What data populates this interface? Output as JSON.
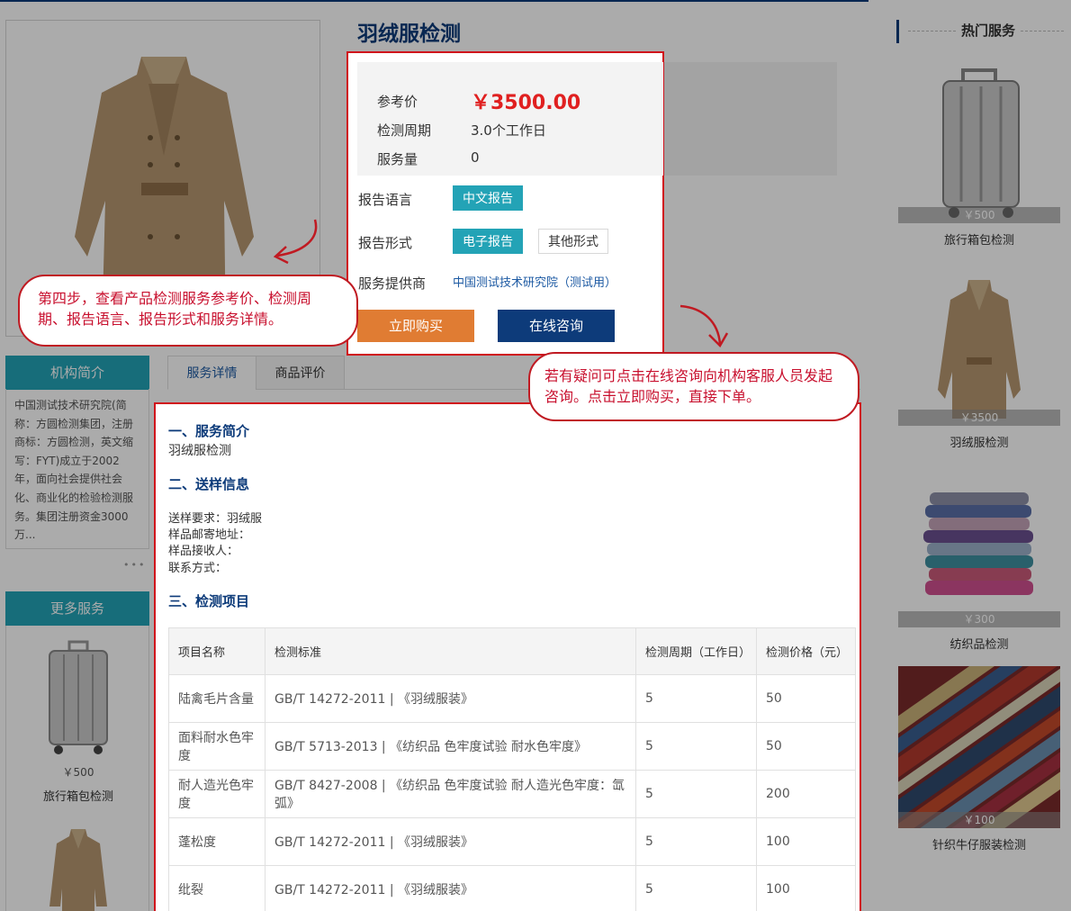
{
  "product": {
    "title": "羽绒服检测",
    "price_label": "参考价",
    "price": "￥3500.00",
    "cycle_label": "检测周期",
    "cycle": "3.0个工作日",
    "volume_label": "服务量",
    "volume": "0",
    "lang_label": "报告语言",
    "lang_option": "中文报告",
    "format_label": "报告形式",
    "format_options": [
      "电子报告",
      "其他形式"
    ],
    "provider_label": "服务提供商",
    "provider": "中国测试技术研究院（测试用）",
    "buy_button": "立即购买",
    "consult_button": "在线咨询"
  },
  "org": {
    "heading": "机构简介",
    "description": "中国测试技术研究院(简称：方圆检测集团，注册商标：方圆检测，英文缩写：FYT)成立于2002年，面向社会提供社会化、商业化的检验检测服务。集团注册资金3000万...",
    "more_dots": "•••"
  },
  "more": {
    "heading": "更多服务",
    "items": [
      {
        "price": "￥500",
        "name": "旅行箱包检测"
      }
    ]
  },
  "tabs": [
    "服务详情",
    "商品评价"
  ],
  "detail": {
    "sec1_title": "一、服务简介",
    "sec1_text": "羽绒服检测",
    "sec2_title": "二、送样信息",
    "sample_req": "送样要求：羽绒服",
    "sample_addr": "样品邮寄地址：",
    "sample_recv": "样品接收人：",
    "contact": "联系方式：",
    "sec3_title": "三、检测项目",
    "table_headers": [
      "项目名称",
      "检测标准",
      "检测周期（工作日）",
      "检测价格（元）"
    ],
    "rows": [
      [
        "陆禽毛片含量",
        "GB/T 14272-2011 | 《羽绒服装》",
        "5",
        "50"
      ],
      [
        "面料耐水色牢度",
        "GB/T 5713-2013 | 《纺织品 色牢度试验 耐水色牢度》",
        "5",
        "50"
      ],
      [
        "耐人造光色牢度",
        "GB/T 8427-2008 | 《纺织品 色牢度试验 耐人造光色牢度：氙弧》",
        "5",
        "200"
      ],
      [
        "蓬松度",
        "GB/T 14272-2011 | 《羽绒服装》",
        "5",
        "100"
      ],
      [
        "纰裂",
        "GB/T 14272-2011 | 《羽绒服装》",
        "5",
        "100"
      ]
    ]
  },
  "hot": {
    "heading": "热门服务",
    "items": [
      {
        "price": "￥500",
        "name": "旅行箱包检测",
        "icon": "suitcase-image"
      },
      {
        "price": "￥3500",
        "name": "羽绒服检测",
        "icon": "coat-image"
      },
      {
        "price": "￥300",
        "name": "纺织品检测",
        "icon": "textile-stack-image"
      },
      {
        "price": "￥100",
        "name": "针织牛仔服装检测",
        "icon": "fabric-image"
      }
    ]
  },
  "callouts": {
    "step4": "第四步，查看产品检测服务参考价、检测周期、报告语言、报告形式和服务详情。",
    "consult_tip": "若有疑问可点击在线咨询向机构客服人员发起咨询。点击立即购买，直接下单。"
  },
  "colors": {
    "brand": "#0d3b7a",
    "accent": "#23a3b6",
    "buy": "#e07c33",
    "price": "#e02020",
    "highlight": "#d0111b"
  }
}
